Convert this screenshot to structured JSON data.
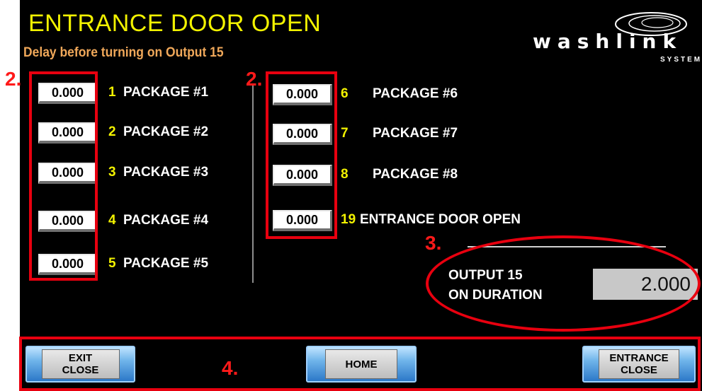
{
  "screen": {
    "title": "ENTRANCE DOOR OPEN",
    "subtitle": "Delay before turning on Output 15"
  },
  "logo": {
    "text": "washlink",
    "subtext": "SYSTEMS"
  },
  "left_column": [
    {
      "value": "0.000",
      "num": "1",
      "label": "PACKAGE #1"
    },
    {
      "value": "0.000",
      "num": "2",
      "label": "PACKAGE #2"
    },
    {
      "value": "0.000",
      "num": "3",
      "label": "PACKAGE #3"
    },
    {
      "value": "0.000",
      "num": "4",
      "label": "PACKAGE #4"
    },
    {
      "value": "0.000",
      "num": "5",
      "label": "PACKAGE #5"
    }
  ],
  "right_column": [
    {
      "value": "0.000",
      "num": "6",
      "label": "PACKAGE #6"
    },
    {
      "value": "0.000",
      "num": "7",
      "label": "PACKAGE #7"
    },
    {
      "value": "0.000",
      "num": "8",
      "label": "PACKAGE #8"
    },
    {
      "value": "0.000",
      "num": "19",
      "label": "ENTRANCE DOOR OPEN"
    }
  ],
  "duration": {
    "label_line1": "OUTPUT 15",
    "label_line2": "ON DURATION",
    "value": "2.000"
  },
  "buttons": {
    "exit": {
      "line1": "EXIT",
      "line2": "CLOSE"
    },
    "home": {
      "label": "HOME"
    },
    "entrance": {
      "line1": "ENTRANCE",
      "line2": "CLOSE"
    }
  },
  "annotations": {
    "a2_left": "2.",
    "a2_right": "2.",
    "a3": "3.",
    "a4": "4."
  },
  "colors": {
    "title": "#f2f200",
    "subtitle": "#f0a85a",
    "annotation_red": "#e8000f",
    "screen_bg": "#000000"
  }
}
